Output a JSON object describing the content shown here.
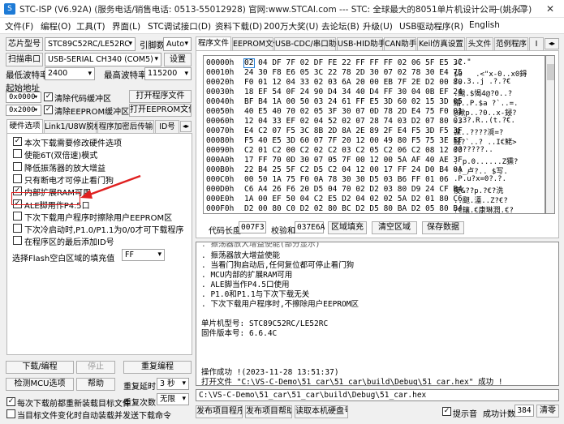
{
  "window": {
    "title": "STC-ISP (V6.92A) (服务电话/销售电话: 0513-55012928) 官网:www.STCAI.com  --- STC: 全球最大的8051单片机设计公司 (姚永平)",
    "icon": "S"
  },
  "menu": [
    "文件(F)",
    "编程(O)",
    "工具(T)",
    "界面(L)",
    "STC调试接口(D)",
    "资料下载(D)",
    "200万大奖(U)",
    "去论坛(B)",
    "升级(U)",
    "USB驱动程序(R)",
    "English"
  ],
  "left": {
    "chip_label": "芯片型号",
    "chip_value": "STC89C52RC/LE52RC",
    "pins_label": "引脚数",
    "pins_value": "Auto",
    "scan_button": "扫描串口",
    "port_value": "USB-SERIAL CH340 (COM5)",
    "settings_button": "设置",
    "min_baud_label": "最低波特率",
    "min_baud_value": "2400",
    "max_baud_label": "最高波特率",
    "max_baud_value": "115200",
    "start_addr_label": "起始地址",
    "addr1": "0x0000",
    "clear_code_label": "清除代码缓冲区",
    "open_program_button": "打开程序文件",
    "addr2": "0x2000",
    "clear_eeprom_label": "清除EEPROM缓冲区",
    "open_eeprom_button": "打开EEPROM文件",
    "tabs": [
      "硬件选项",
      "Link1/U8W脱机",
      "程序加密后传输",
      "ID号"
    ],
    "options": [
      {
        "label": "本次下载需要修改硬件选项",
        "checked": true
      },
      {
        "label": "使能6T(双倍速)模式",
        "checked": false
      },
      {
        "label": "降低振荡器的放大增益",
        "checked": false
      },
      {
        "label": "只有断电才可停止看门狗",
        "checked": false
      },
      {
        "label": "内部扩展RAM可用",
        "checked": true
      },
      {
        "label": "ALE脚用作P4.5口",
        "checked": true
      },
      {
        "label": "下次下载用户程序时擦除用户EEPROM区",
        "checked": false
      },
      {
        "label": "下次冷启动时,P1.0/P1.1为0/0才可下载程序",
        "checked": false
      },
      {
        "label": "在程序区的最后添加ID号",
        "checked": false
      }
    ],
    "flash_fill_label": "选择Flash空白区域的填充值",
    "flash_fill_value": "FF",
    "download_button": "下载/编程",
    "stop_button": "停止",
    "reprogram_button": "重复编程",
    "check_mcu_button": "检测MCU选项",
    "help_button": "帮助",
    "repeat_delay_label": "重复延时",
    "repeat_delay_value": "3 秒",
    "reload_label": "每次下载前都重新装载目标文件",
    "repeat_count_label": "重复次数",
    "repeat_count_value": "无限",
    "auto_send_label": "当目标文件变化时自动装载并发送下载命令",
    "reload_checked": true,
    "auto_send_checked": false
  },
  "right": {
    "tabs": [
      "程序文件",
      "EEPROM文件",
      "USB-CDC/串口助手",
      "USB-HID助手",
      "CAN助手",
      "Keil仿真设置",
      "头文件",
      "范例程序"
    ],
    "hex_rows": [
      {
        "addr": "00000h",
        "bytes": "02 04 DF 7F 02 DF FE 22 FF FF FF 02 06 5F E5 3C",
        "ascii": ".?.\""
      },
      {
        "addr": "00010h",
        "bytes": "24 30 F8 E6 05 3C 22 78 2D 30 07 02 78 30 E4 75",
        "ascii": "$0   .<\"x-0..x0鍀"
      },
      {
        "addr": "00020h",
        "bytes": "F0 01 12 04 33 02 03 6A 20 00 EB 7F 2E D2 00 80",
        "ascii": "?..3..j .?.?€"
      },
      {
        "addr": "00030h",
        "bytes": "18 EF 54 0F 24 90 D4 34 40 D4 FF 30 04 0B EF 24",
        "ascii": ".颰.$愒4@?0..?"
      },
      {
        "addr": "00040h",
        "bytes": "BF B4 1A 00 50 03 24 61 FF E5 3D 60 02 15 3D 05",
        "ascii": "繒..P.$a ?`..=."
      },
      {
        "addr": "00050h",
        "bytes": "40 E5 40 70 02 05 3F 30 07 0D 78 2D E4 75 F0 01",
        "ascii": "@鍬p..?0..x-鋟?"
      },
      {
        "addr": "00060h",
        "bytes": "12 04 33 EF 02 04 52 02 07 28 74 03 D2 07 80 03",
        "ascii": "..3?.R..(t.?€."
      },
      {
        "addr": "00070h",
        "eep": "",
        "bytes": "E4 C2 07 F5 3C 8B 2D 8A 2E 89 2F E4 F5 3D F5 3F",
        "ascii": "淭..????漞=?"
      },
      {
        "addr": "00080h",
        "bytes": "F5 40 E5 3D 60 07 7F 20 12 00 49 80 F5 75 3E FF",
        "ascii": "鮼?`..? ..I€鮱>"
      },
      {
        "addr": "00090h",
        "bytes": "C2 01 C2 00 C2 02 C2 03 C2 05 C2 06 C2 08 12 00",
        "ascii": "???????.."
      },
      {
        "addr": "000A0h",
        "bytes": "17 FF 70 0D 30 07 05 7F 00 12 00 5A AF 40 AE 3F",
        "ascii": ". p.0......Z獯?"
      },
      {
        "addr": "000B0h",
        "bytes": "22 B4 25 5F C2 D5 C2 04 12 00 17 FF 24 D0 B4 0A",
        "ascii": "\"?_卢?.. $写."
      },
      {
        "addr": "000C0h",
        "bytes": "00 50 1A 75 F0 0A 78 30 30 D5 03 B6 FF 01 06",
        "ascii": ".P.u?x=0?.?."
      },
      {
        "addr": "000D0h",
        "bytes": "C6 A4 26 F6 20 D5 04 70 02 D2 03 80 D9 24 CF B4",
        "ascii": "痠&??p.?€?洗"
      },
      {
        "addr": "000E0h",
        "bytes": "1A 00 EF 50 04 C2 E5 D2 04 02 02 5A D2 01 80 C6",
        "ascii": "..颬.濭..Z?€?"
      },
      {
        "addr": "000F0h",
        "bytes": "D2 00 80 C0 D2 02 80 BC D2 D5 80 BA D2 05 80 B4",
        "ascii": "?€鑲.€康琳潤.€?"
      }
    ],
    "code_length_label": "代码长度",
    "code_length_value": "007F3",
    "checksum_label": "校验和",
    "checksum_value": "037E6A",
    "fill_area_button": "区域填充",
    "clear_area_button": "清空区域",
    "save_data_button": "保存数据",
    "log_lines": [
      ". 振荡器放大增益使能",
      ". 当看门狗启动后,任何复位都可停止看门狗",
      ". MCU内部的扩展RAM可用",
      ". ALE脚当作P4.5口使用",
      ". P1.0和P1.1与下次下载无关",
      ". 下次下载用户程序时,不擦除用户EEPROM区",
      "",
      "单片机型号: STC89C52RC/LE52RC",
      "固件版本号: 6.6.4C",
      "",
      "",
      "",
      "操作成功 !(2023-11-28 13:51:37)",
      "打开文件 \"C:\\VS-C-Demo\\51_car\\51_car\\build\\Debug\\51_car.hex\" 成功 !"
    ],
    "log_partial_top": ". 振荡器放大增益使能(部分显示)",
    "path_value": "C:\\VS-C-Demo\\51_car\\51_car\\build\\Debug\\51_car.hex",
    "publish_project_button": "发布项目程序",
    "publish_help_button": "发布项目帮助",
    "read_serial_button": "读取本机硬盘号",
    "prompt_sound_label": "提示音",
    "prompt_sound_checked": true,
    "success_count_label": "成功计数",
    "success_count_value": "384",
    "clear_button": "清零"
  },
  "colors": {
    "accent_blue": "#1e7bd6",
    "highlight_red": "#e02020"
  }
}
